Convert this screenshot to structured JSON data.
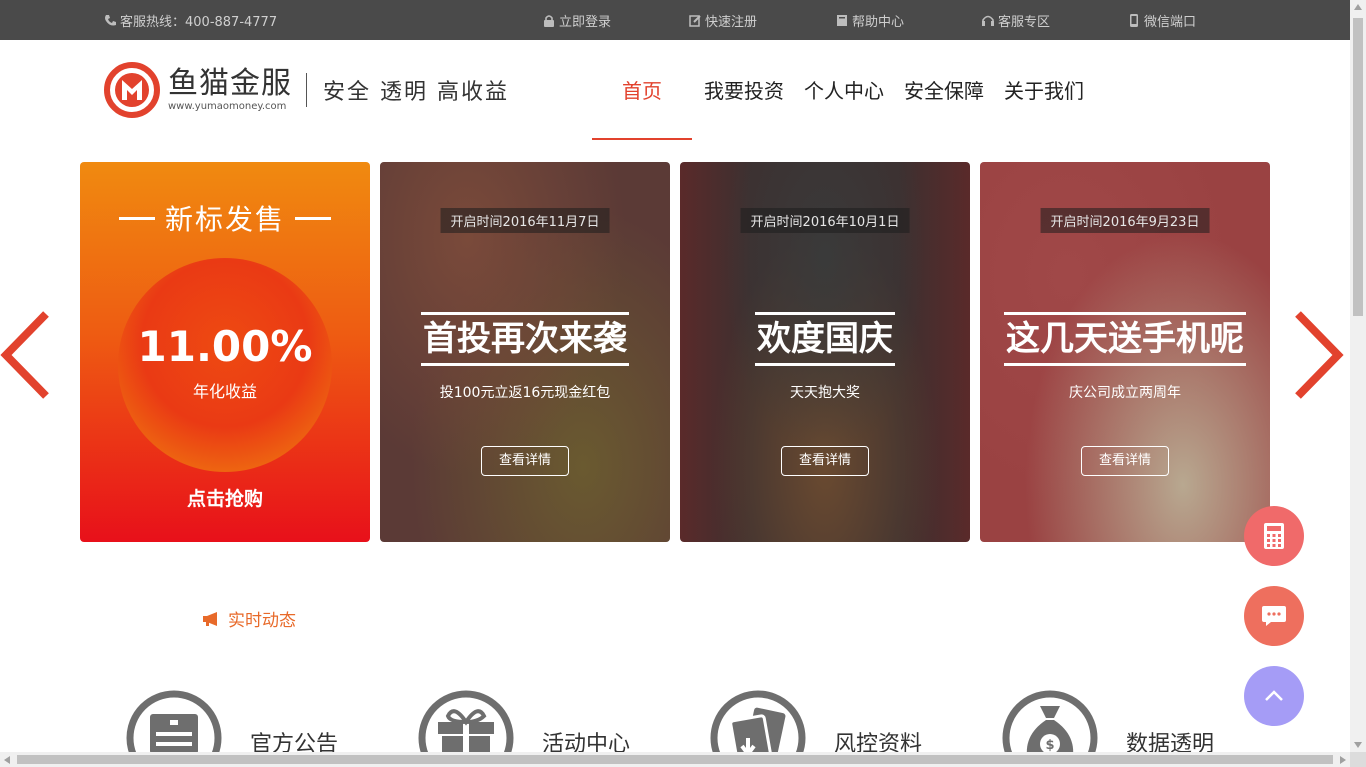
{
  "topbar": {
    "hotline": "客服热线：400-887-4777",
    "links": [
      {
        "label": "立即登录",
        "icon": "lock-icon"
      },
      {
        "label": "快速注册",
        "icon": "edit-icon"
      },
      {
        "label": "帮助中心",
        "icon": "book-icon"
      },
      {
        "label": "客服专区",
        "icon": "headset-icon"
      },
      {
        "label": "微信端口",
        "icon": "mobile-icon"
      }
    ]
  },
  "header": {
    "brand_name": "鱼猫金服",
    "brand_url": "www.yumaomoney.com",
    "slogan": "安全 透明  高收益",
    "nav": [
      "首页",
      "我要投资",
      "个人中心",
      "安全保障",
      "关于我们"
    ],
    "active_nav": "首页"
  },
  "banner": {
    "new_product": {
      "title": "新标发售",
      "rate": "11.00%",
      "rate_label": "年化收益",
      "cta": "点击抢购"
    },
    "events": [
      {
        "date": "开启时间2016年11月7日",
        "title": "首投再次来袭",
        "subtitle": "投100元立返16元现金红包",
        "button": "查看详情"
      },
      {
        "date": "开启时间2016年10月1日",
        "title": "欢度国庆",
        "subtitle": "天天抱大奖",
        "button": "查看详情"
      },
      {
        "date": "开启时间2016年9月23日",
        "title": "这几天送手机呢",
        "subtitle": "庆公司成立两周年",
        "button": "查看详情"
      }
    ]
  },
  "news": {
    "label": "实时动态",
    "icon": "megaphone-icon"
  },
  "features": [
    {
      "label": "官方公告",
      "icon": "notice-board-icon"
    },
    {
      "label": "活动中心",
      "icon": "gift-icon"
    },
    {
      "label": "风控资料",
      "icon": "documents-icon"
    },
    {
      "label": "数据透明",
      "icon": "money-bag-icon"
    }
  ],
  "floating": [
    {
      "name": "calculator",
      "icon": "calculator-icon",
      "color": "#f06a6a"
    },
    {
      "name": "chat",
      "icon": "chat-icon",
      "color": "#ee6f5e"
    },
    {
      "name": "back-to-top",
      "icon": "chevron-up-icon",
      "color": "#a59cf6"
    }
  ],
  "colors": {
    "accent": "#e2422d",
    "topbar_bg": "#4a4a4a",
    "news": "#e86a2a"
  }
}
